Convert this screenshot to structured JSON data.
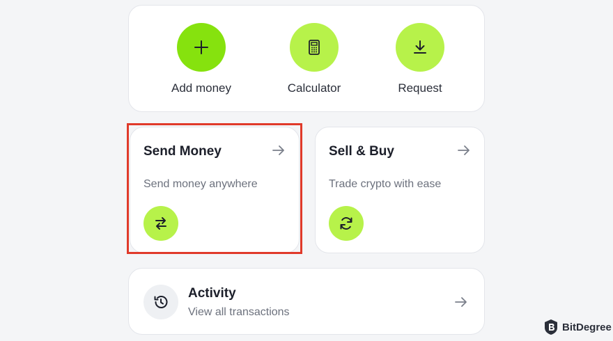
{
  "quick_actions": [
    {
      "label": "Add money",
      "icon": "plus-icon"
    },
    {
      "label": "Calculator",
      "icon": "calculator-icon"
    },
    {
      "label": "Request",
      "icon": "download-icon"
    }
  ],
  "cards": {
    "send": {
      "title": "Send Money",
      "subtitle": "Send money anywhere",
      "icon": "swap-arrows-icon"
    },
    "sell": {
      "title": "Sell & Buy",
      "subtitle": "Trade crypto with ease",
      "icon": "refresh-icon"
    }
  },
  "activity": {
    "title": "Activity",
    "subtitle": "View all transactions",
    "icon": "history-icon"
  },
  "brand": {
    "name": "BitDegree"
  },
  "colors": {
    "accent": "#b7f24a",
    "accent_primary": "#86e20e",
    "highlight": "#e03a2a",
    "card_bg": "#ffffff",
    "page_bg": "#f4f5f7"
  }
}
